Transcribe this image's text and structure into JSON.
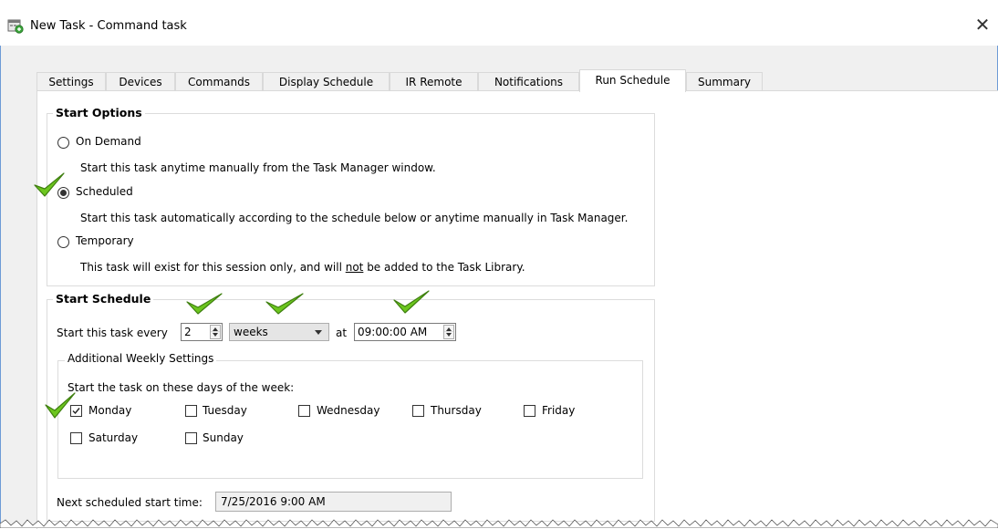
{
  "window": {
    "title": "New Task - Command task",
    "close_glyph": "✕"
  },
  "tabs": [
    {
      "label": "Settings"
    },
    {
      "label": "Devices"
    },
    {
      "label": "Commands"
    },
    {
      "label": "Display Schedule"
    },
    {
      "label": "IR Remote"
    },
    {
      "label": "Notifications"
    },
    {
      "label": "Run Schedule",
      "active": true
    },
    {
      "label": "Summary"
    }
  ],
  "start_options": {
    "title": "Start Options",
    "on_demand": {
      "label": "On Demand",
      "description": "Start this task anytime manually from the Task Manager window.",
      "checked": false
    },
    "scheduled": {
      "label": "Scheduled",
      "description": "Start this task automatically according to the schedule below or anytime manually in Task Manager.",
      "checked": true
    },
    "temporary": {
      "label": "Temporary",
      "description_before": "This task will exist for this session only, and will ",
      "description_underlined": "not",
      "description_after": " be added to the Task Library.",
      "checked": false
    }
  },
  "start_schedule": {
    "title": "Start Schedule",
    "every_label": "Start this task every",
    "every_value": "2",
    "unit_value": "weeks",
    "at_label": "at",
    "time_value": "09:00:00 AM",
    "weekly": {
      "title": "Additional Weekly Settings",
      "prompt": "Start the task on these days of the week:",
      "days": [
        {
          "label": "Monday",
          "checked": true
        },
        {
          "label": "Tuesday",
          "checked": false
        },
        {
          "label": "Wednesday",
          "checked": false
        },
        {
          "label": "Thursday",
          "checked": false
        },
        {
          "label": "Friday",
          "checked": false
        },
        {
          "label": "Saturday",
          "checked": false
        },
        {
          "label": "Sunday",
          "checked": false
        }
      ]
    },
    "next_label": "Next scheduled start time:",
    "next_value": "7/25/2016 9:00 AM"
  },
  "colors": {
    "annotation_check": "#6cc61e",
    "annotation_outline": "#3f7f10"
  }
}
